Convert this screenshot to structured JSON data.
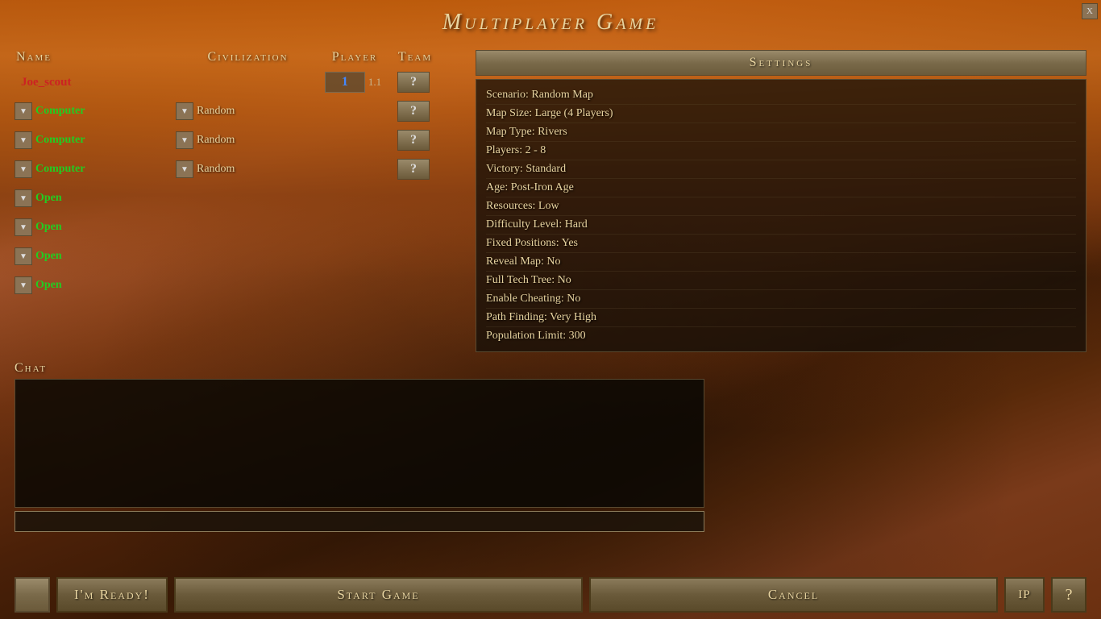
{
  "window": {
    "title": "Multiplayer Game",
    "close_label": "X"
  },
  "columns": {
    "name": "Name",
    "civilization": "Civilization",
    "player": "Player",
    "team": "Team"
  },
  "players": [
    {
      "name": "Joe_scout",
      "name_color": "red",
      "is_host": true,
      "civilization": null,
      "player_num": "1",
      "player_static": "1.1",
      "team": "?",
      "has_dropdown": false
    },
    {
      "name": "Computer",
      "name_color": "green",
      "is_host": false,
      "civilization": "Random",
      "player_num": null,
      "team": "?",
      "has_dropdown": true
    },
    {
      "name": "Computer",
      "name_color": "green",
      "is_host": false,
      "civilization": "Random",
      "player_num": null,
      "team": "?",
      "has_dropdown": true
    },
    {
      "name": "Computer",
      "name_color": "green",
      "is_host": false,
      "civilization": "Random",
      "player_num": null,
      "team": "?",
      "has_dropdown": true
    },
    {
      "name": "Open",
      "name_color": "green",
      "is_host": false,
      "civilization": null,
      "player_num": null,
      "team": null,
      "has_dropdown": true
    },
    {
      "name": "Open",
      "name_color": "green",
      "is_host": false,
      "civilization": null,
      "player_num": null,
      "team": null,
      "has_dropdown": true
    },
    {
      "name": "Open",
      "name_color": "green",
      "is_host": false,
      "civilization": null,
      "player_num": null,
      "team": null,
      "has_dropdown": true
    },
    {
      "name": "Open",
      "name_color": "green",
      "is_host": false,
      "civilization": null,
      "player_num": null,
      "team": null,
      "has_dropdown": true
    }
  ],
  "settings": {
    "header": "Settings",
    "items": [
      "Scenario: Random Map",
      "Map Size: Large (4 Players)",
      "Map Type: Rivers",
      "Players: 2 - 8",
      "Victory: Standard",
      "Age: Post-Iron Age",
      "Resources: Low",
      "Difficulty Level: Hard",
      "Fixed Positions: Yes",
      "Reveal Map: No",
      "Full Tech Tree: No",
      "Enable Cheating: No",
      "Path Finding: Very High",
      "Population Limit: 300"
    ]
  },
  "chat": {
    "label": "Chat",
    "input_placeholder": ""
  },
  "buttons": {
    "ready_label": "I'm Ready!",
    "start_label": "Start Game",
    "cancel_label": "Cancel",
    "ip_label": "IP",
    "help_label": "?"
  }
}
